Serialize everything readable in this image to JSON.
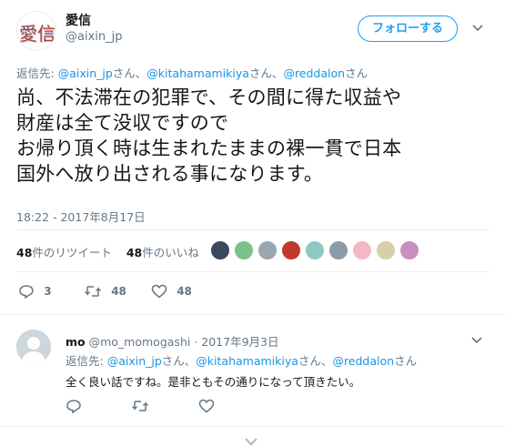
{
  "author": {
    "avatar_text": "愛信",
    "name": "愛信",
    "handle": "@aixin_jp"
  },
  "follow_label": "フォローする",
  "reply_to": {
    "prefix": "返信先: ",
    "user1": "@aixin_jp",
    "suffix1": "さん、",
    "user2": "@kitahamamikiya",
    "suffix2": "さん、",
    "user3": "@reddalon",
    "suffix3": "さん"
  },
  "tweet_lines": [
    "尚、不法滞在の犯罪で、その間に得た収益や",
    "財産は全て没収ですので",
    "お帰り頂く時は生まれたままの裸一貫で日本",
    "国外へ放り出される事になります。"
  ],
  "timestamp": "18:22 - 2017年8月17日",
  "stats": {
    "retweets_count": "48",
    "retweets_label": "件のリツイート",
    "likes_count": "48",
    "likes_label": "件のいいね"
  },
  "liker_avatar_colors": [
    "#3a4a5c",
    "#7cc08a",
    "#9aa6b0",
    "#c0392b",
    "#8fc9c4",
    "#8a9aa8",
    "#f2b8c6",
    "#d8cfa8",
    "#c98fbf"
  ],
  "actions": {
    "reply_count": "3",
    "retweet_count": "48",
    "like_count": "48"
  },
  "reply": {
    "name": "mo",
    "handle": "@mo_momogashi",
    "separator": " · ",
    "date": "2017年9月3日",
    "reply_to": {
      "prefix": "返信先: ",
      "user1": "@aixin_jp",
      "suffix1": "さん、",
      "user2": "@kitahamamikiya",
      "suffix2": "さん、",
      "user3": "@reddalon",
      "suffix3": "さん"
    },
    "text": "全く良い話ですね。是非ともその通りになって頂きたい。"
  },
  "colors": {
    "accent": "#1da1f2",
    "link": "#1b95e0",
    "muted": "#657786"
  }
}
